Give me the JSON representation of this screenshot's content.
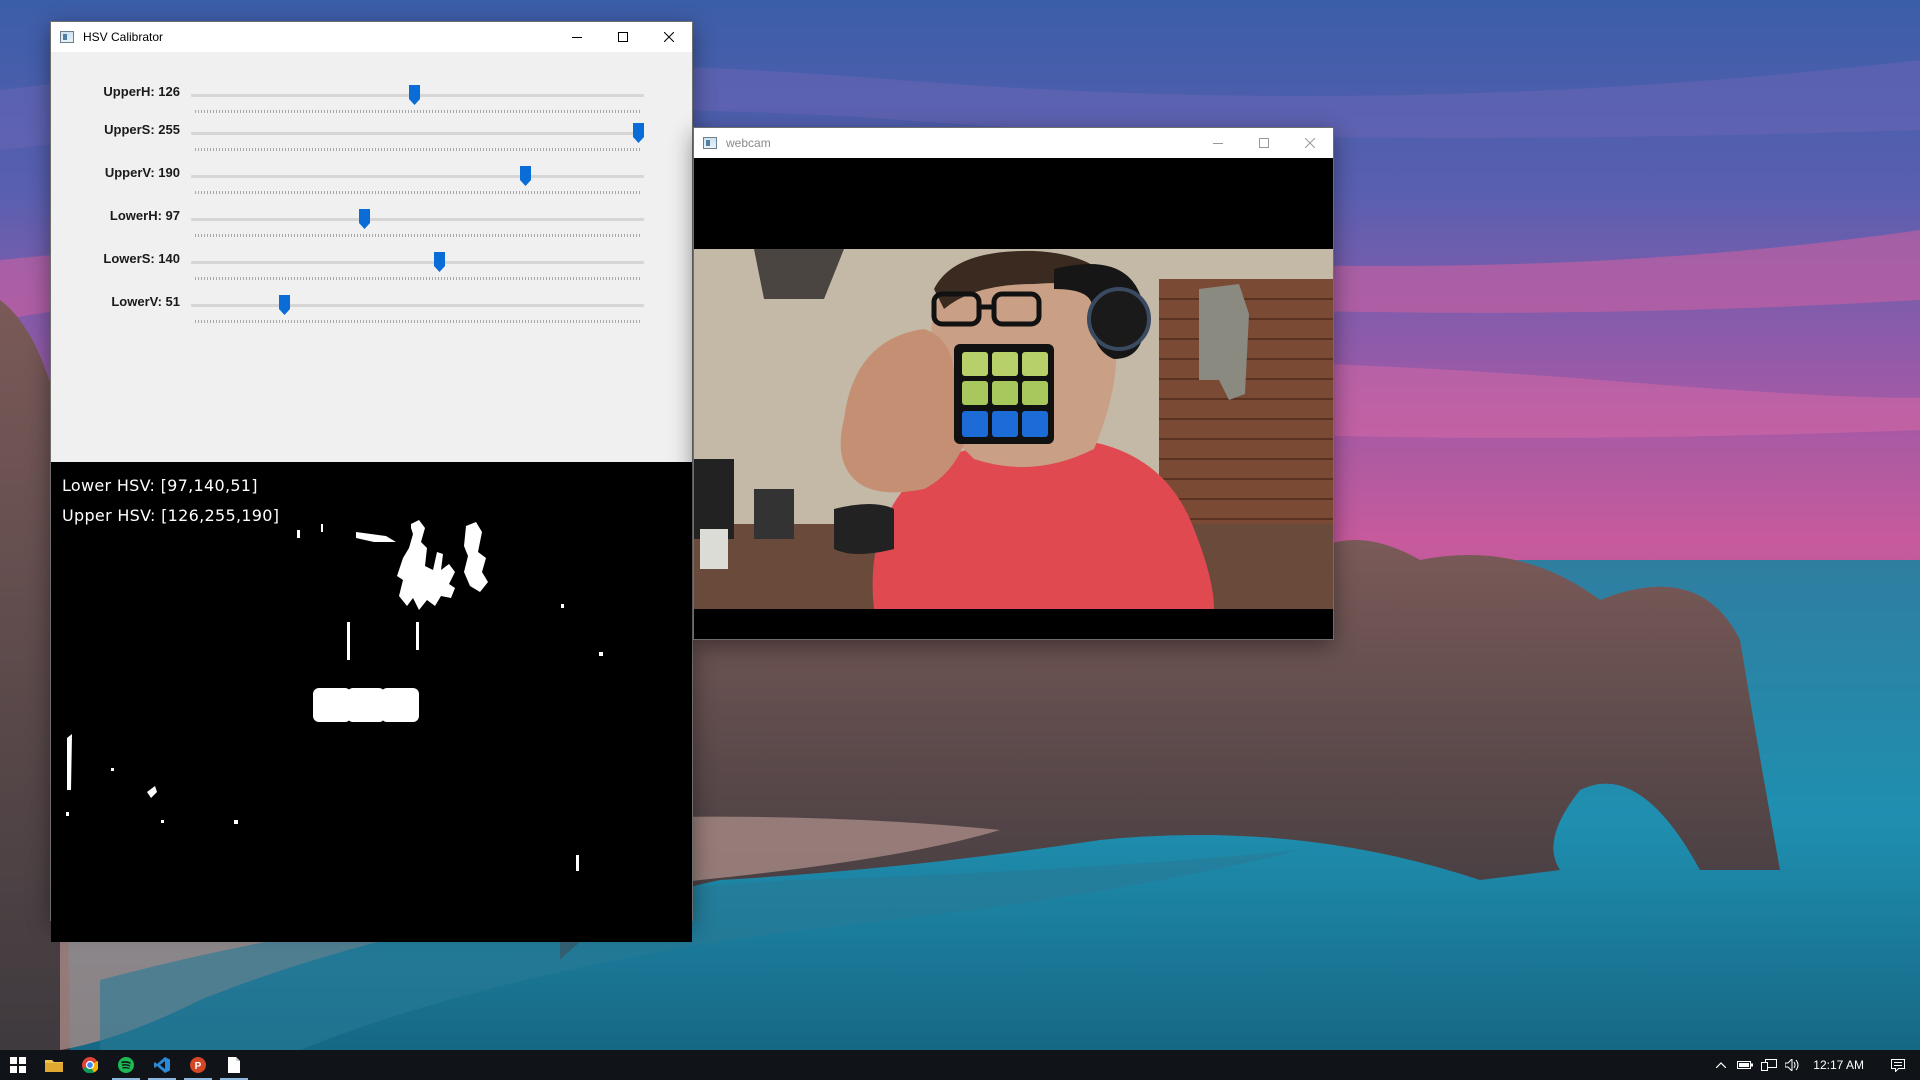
{
  "desktop": {
    "wallpaper": "coastal-arch-sunset"
  },
  "hsv_window": {
    "title": "HSV Calibrator",
    "sliders": [
      {
        "label": "UpperH: 126",
        "value": 126,
        "max": 255
      },
      {
        "label": "UpperS: 255",
        "value": 255,
        "max": 255
      },
      {
        "label": "UpperV: 190",
        "value": 190,
        "max": 255
      },
      {
        "label": "LowerH: 97",
        "value": 97,
        "max": 255
      },
      {
        "label": "LowerS: 140",
        "value": 140,
        "max": 255
      },
      {
        "label": "LowerV: 51",
        "value": 51,
        "max": 255
      }
    ],
    "mask_text": {
      "lower": "Lower HSV: [97,140,51]",
      "upper": "Upper HSV: [126,255,190]"
    }
  },
  "webcam_window": {
    "title": "webcam"
  },
  "taskbar": {
    "apps": [
      "start-icon",
      "file-explorer-icon",
      "chrome-icon",
      "spotify-icon",
      "vscode-icon",
      "powerpoint-icon",
      "notepad-icon"
    ],
    "clock": "12:17 AM",
    "tray": [
      "chevron-up-icon",
      "battery-icon",
      "network-icon",
      "volume-icon",
      "notifications-icon"
    ]
  },
  "colors": {
    "accent": "#0078d7",
    "thumb": "#0a6cd6",
    "taskbar": "#101418"
  }
}
